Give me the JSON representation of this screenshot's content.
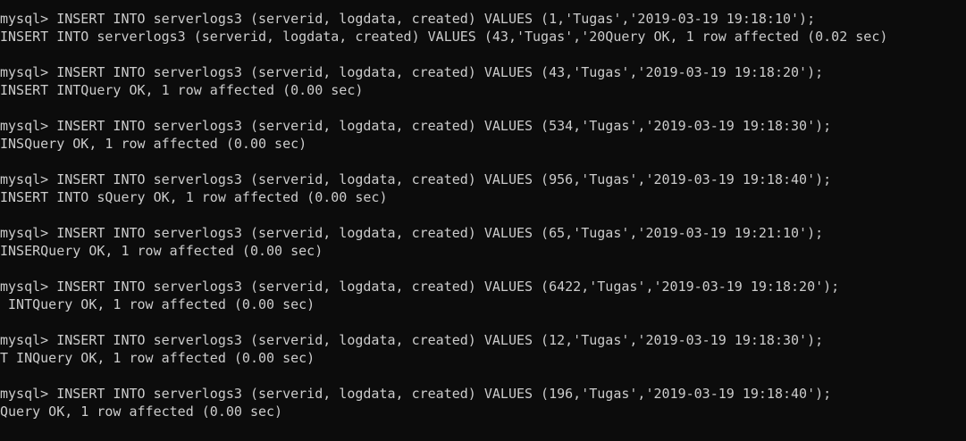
{
  "terminal": {
    "background": "#0c0c0c",
    "foreground": "#cccccc",
    "lines": [
      "mysql> INSERT INTO serverlogs3 (serverid, logdata, created) VALUES (1,'Tugas','2019-03-19 19:18:10');",
      "INSERT INTO serverlogs3 (serverid, logdata, created) VALUES (43,'Tugas','20Query OK, 1 row affected (0.02 sec)",
      "",
      "mysql> INSERT INTO serverlogs3 (serverid, logdata, created) VALUES (43,'Tugas','2019-03-19 19:18:20');",
      "INSERT INTQuery OK, 1 row affected (0.00 sec)",
      "",
      "mysql> INSERT INTO serverlogs3 (serverid, logdata, created) VALUES (534,'Tugas','2019-03-19 19:18:30');",
      "INSQuery OK, 1 row affected (0.00 sec)",
      "",
      "mysql> INSERT INTO serverlogs3 (serverid, logdata, created) VALUES (956,'Tugas','2019-03-19 19:18:40');",
      "INSERT INTO sQuery OK, 1 row affected (0.00 sec)",
      "",
      "mysql> INSERT INTO serverlogs3 (serverid, logdata, created) VALUES (65,'Tugas','2019-03-19 19:21:10');",
      "INSERQuery OK, 1 row affected (0.00 sec)",
      "",
      "mysql> INSERT INTO serverlogs3 (serverid, logdata, created) VALUES (6422,'Tugas','2019-03-19 19:18:20');",
      " INTQuery OK, 1 row affected (0.00 sec)",
      "",
      "mysql> INSERT INTO serverlogs3 (serverid, logdata, created) VALUES (12,'Tugas','2019-03-19 19:18:30');",
      "T INQuery OK, 1 row affected (0.00 sec)",
      "",
      "mysql> INSERT INTO serverlogs3 (serverid, logdata, created) VALUES (196,'Tugas','2019-03-19 19:18:40');",
      "Query OK, 1 row affected (0.00 sec)"
    ]
  }
}
